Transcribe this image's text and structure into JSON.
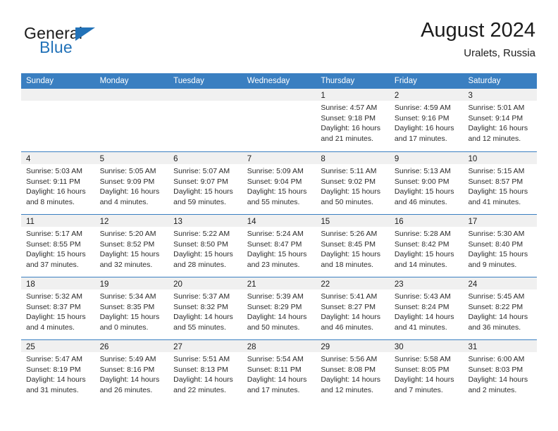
{
  "brand": {
    "word_one": "General",
    "word_two": "Blue",
    "flag_icon": "triangle-flag-icon"
  },
  "header": {
    "month_title": "August 2024",
    "location": "Uralets, Russia"
  },
  "colors": {
    "header_blue": "#3a7fc1",
    "brand_blue": "#2272b8",
    "day_band_gray": "#f0f0f0",
    "text": "#1c1c1c"
  },
  "weekdays": [
    "Sunday",
    "Monday",
    "Tuesday",
    "Wednesday",
    "Thursday",
    "Friday",
    "Saturday"
  ],
  "weeks": [
    [
      {
        "day": "",
        "lines": []
      },
      {
        "day": "",
        "lines": []
      },
      {
        "day": "",
        "lines": []
      },
      {
        "day": "",
        "lines": []
      },
      {
        "day": "1",
        "lines": [
          "Sunrise: 4:57 AM",
          "Sunset: 9:18 PM",
          "Daylight: 16 hours",
          "and 21 minutes."
        ]
      },
      {
        "day": "2",
        "lines": [
          "Sunrise: 4:59 AM",
          "Sunset: 9:16 PM",
          "Daylight: 16 hours",
          "and 17 minutes."
        ]
      },
      {
        "day": "3",
        "lines": [
          "Sunrise: 5:01 AM",
          "Sunset: 9:14 PM",
          "Daylight: 16 hours",
          "and 12 minutes."
        ]
      }
    ],
    [
      {
        "day": "4",
        "lines": [
          "Sunrise: 5:03 AM",
          "Sunset: 9:11 PM",
          "Daylight: 16 hours",
          "and 8 minutes."
        ]
      },
      {
        "day": "5",
        "lines": [
          "Sunrise: 5:05 AM",
          "Sunset: 9:09 PM",
          "Daylight: 16 hours",
          "and 4 minutes."
        ]
      },
      {
        "day": "6",
        "lines": [
          "Sunrise: 5:07 AM",
          "Sunset: 9:07 PM",
          "Daylight: 15 hours",
          "and 59 minutes."
        ]
      },
      {
        "day": "7",
        "lines": [
          "Sunrise: 5:09 AM",
          "Sunset: 9:04 PM",
          "Daylight: 15 hours",
          "and 55 minutes."
        ]
      },
      {
        "day": "8",
        "lines": [
          "Sunrise: 5:11 AM",
          "Sunset: 9:02 PM",
          "Daylight: 15 hours",
          "and 50 minutes."
        ]
      },
      {
        "day": "9",
        "lines": [
          "Sunrise: 5:13 AM",
          "Sunset: 9:00 PM",
          "Daylight: 15 hours",
          "and 46 minutes."
        ]
      },
      {
        "day": "10",
        "lines": [
          "Sunrise: 5:15 AM",
          "Sunset: 8:57 PM",
          "Daylight: 15 hours",
          "and 41 minutes."
        ]
      }
    ],
    [
      {
        "day": "11",
        "lines": [
          "Sunrise: 5:17 AM",
          "Sunset: 8:55 PM",
          "Daylight: 15 hours",
          "and 37 minutes."
        ]
      },
      {
        "day": "12",
        "lines": [
          "Sunrise: 5:20 AM",
          "Sunset: 8:52 PM",
          "Daylight: 15 hours",
          "and 32 minutes."
        ]
      },
      {
        "day": "13",
        "lines": [
          "Sunrise: 5:22 AM",
          "Sunset: 8:50 PM",
          "Daylight: 15 hours",
          "and 28 minutes."
        ]
      },
      {
        "day": "14",
        "lines": [
          "Sunrise: 5:24 AM",
          "Sunset: 8:47 PM",
          "Daylight: 15 hours",
          "and 23 minutes."
        ]
      },
      {
        "day": "15",
        "lines": [
          "Sunrise: 5:26 AM",
          "Sunset: 8:45 PM",
          "Daylight: 15 hours",
          "and 18 minutes."
        ]
      },
      {
        "day": "16",
        "lines": [
          "Sunrise: 5:28 AM",
          "Sunset: 8:42 PM",
          "Daylight: 15 hours",
          "and 14 minutes."
        ]
      },
      {
        "day": "17",
        "lines": [
          "Sunrise: 5:30 AM",
          "Sunset: 8:40 PM",
          "Daylight: 15 hours",
          "and 9 minutes."
        ]
      }
    ],
    [
      {
        "day": "18",
        "lines": [
          "Sunrise: 5:32 AM",
          "Sunset: 8:37 PM",
          "Daylight: 15 hours",
          "and 4 minutes."
        ]
      },
      {
        "day": "19",
        "lines": [
          "Sunrise: 5:34 AM",
          "Sunset: 8:35 PM",
          "Daylight: 15 hours",
          "and 0 minutes."
        ]
      },
      {
        "day": "20",
        "lines": [
          "Sunrise: 5:37 AM",
          "Sunset: 8:32 PM",
          "Daylight: 14 hours",
          "and 55 minutes."
        ]
      },
      {
        "day": "21",
        "lines": [
          "Sunrise: 5:39 AM",
          "Sunset: 8:29 PM",
          "Daylight: 14 hours",
          "and 50 minutes."
        ]
      },
      {
        "day": "22",
        "lines": [
          "Sunrise: 5:41 AM",
          "Sunset: 8:27 PM",
          "Daylight: 14 hours",
          "and 46 minutes."
        ]
      },
      {
        "day": "23",
        "lines": [
          "Sunrise: 5:43 AM",
          "Sunset: 8:24 PM",
          "Daylight: 14 hours",
          "and 41 minutes."
        ]
      },
      {
        "day": "24",
        "lines": [
          "Sunrise: 5:45 AM",
          "Sunset: 8:22 PM",
          "Daylight: 14 hours",
          "and 36 minutes."
        ]
      }
    ],
    [
      {
        "day": "25",
        "lines": [
          "Sunrise: 5:47 AM",
          "Sunset: 8:19 PM",
          "Daylight: 14 hours",
          "and 31 minutes."
        ]
      },
      {
        "day": "26",
        "lines": [
          "Sunrise: 5:49 AM",
          "Sunset: 8:16 PM",
          "Daylight: 14 hours",
          "and 26 minutes."
        ]
      },
      {
        "day": "27",
        "lines": [
          "Sunrise: 5:51 AM",
          "Sunset: 8:13 PM",
          "Daylight: 14 hours",
          "and 22 minutes."
        ]
      },
      {
        "day": "28",
        "lines": [
          "Sunrise: 5:54 AM",
          "Sunset: 8:11 PM",
          "Daylight: 14 hours",
          "and 17 minutes."
        ]
      },
      {
        "day": "29",
        "lines": [
          "Sunrise: 5:56 AM",
          "Sunset: 8:08 PM",
          "Daylight: 14 hours",
          "and 12 minutes."
        ]
      },
      {
        "day": "30",
        "lines": [
          "Sunrise: 5:58 AM",
          "Sunset: 8:05 PM",
          "Daylight: 14 hours",
          "and 7 minutes."
        ]
      },
      {
        "day": "31",
        "lines": [
          "Sunrise: 6:00 AM",
          "Sunset: 8:03 PM",
          "Daylight: 14 hours",
          "and 2 minutes."
        ]
      }
    ]
  ]
}
